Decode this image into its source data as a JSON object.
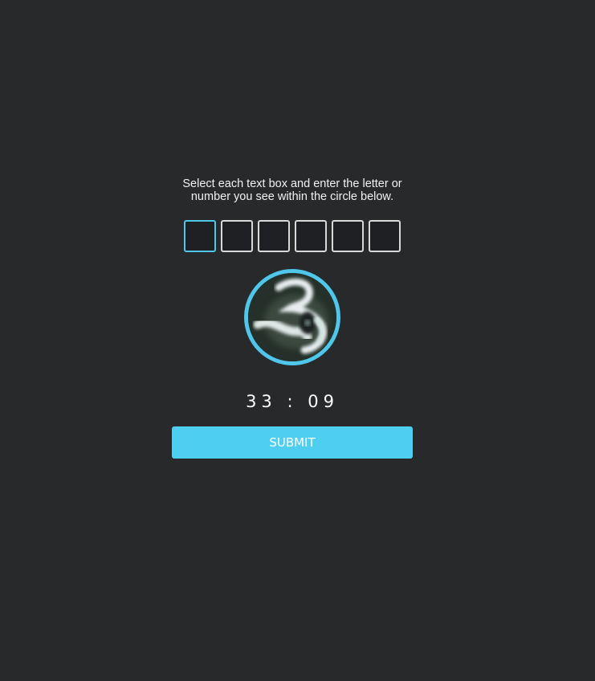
{
  "instructions": "Select each text box and enter the letter or number you see within the circle below.",
  "code_inputs": [
    {
      "value": "",
      "active": true
    },
    {
      "value": "",
      "active": false
    },
    {
      "value": "",
      "active": false
    },
    {
      "value": "",
      "active": false
    },
    {
      "value": "",
      "active": false
    },
    {
      "value": "",
      "active": false
    }
  ],
  "captcha_image": {
    "icon": "captcha-character-image"
  },
  "timer": "33 : 09",
  "submit_label": "SUBMIT",
  "colors": {
    "background": "#27292b",
    "accent": "#4fc6ea",
    "button": "#4ecff2"
  }
}
